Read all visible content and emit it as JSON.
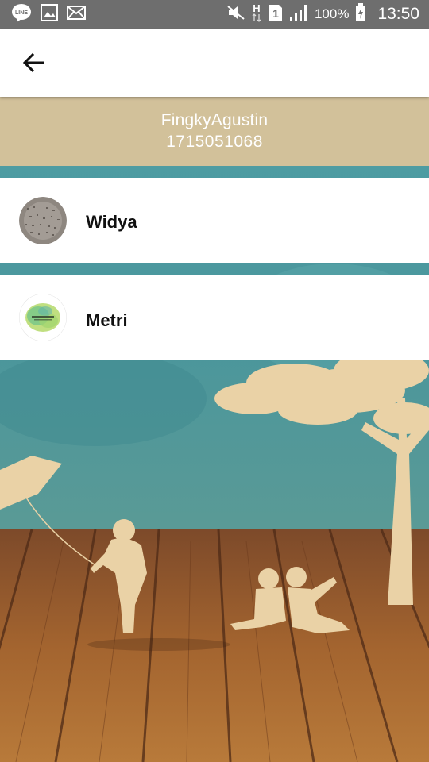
{
  "status_bar": {
    "left_icons": [
      "line-icon",
      "image-icon",
      "mail-icon"
    ],
    "right_icons": [
      "mute-icon",
      "h-network-icon",
      "sim1-icon",
      "signal-icon",
      "battery-charging-icon"
    ],
    "network_label": "H",
    "sim_label": "1",
    "battery": "100%",
    "time": "13:50"
  },
  "app_bar": {
    "back_icon": "arrow-back-icon"
  },
  "profile": {
    "name": "FingkyAgustin",
    "id": "1715051068"
  },
  "contacts": [
    {
      "name": "Widya",
      "avatar": "textured-photo-avatar"
    },
    {
      "name": "Metri",
      "avatar": "green-watercolor-avatar"
    }
  ],
  "colors": {
    "status_bar": "#6e6e6e",
    "header_tan": "#d2c19a",
    "sky_teal": "#4a9aa0",
    "floor_wood": "#9b5a2c",
    "silhouette": "#ead2a6"
  }
}
